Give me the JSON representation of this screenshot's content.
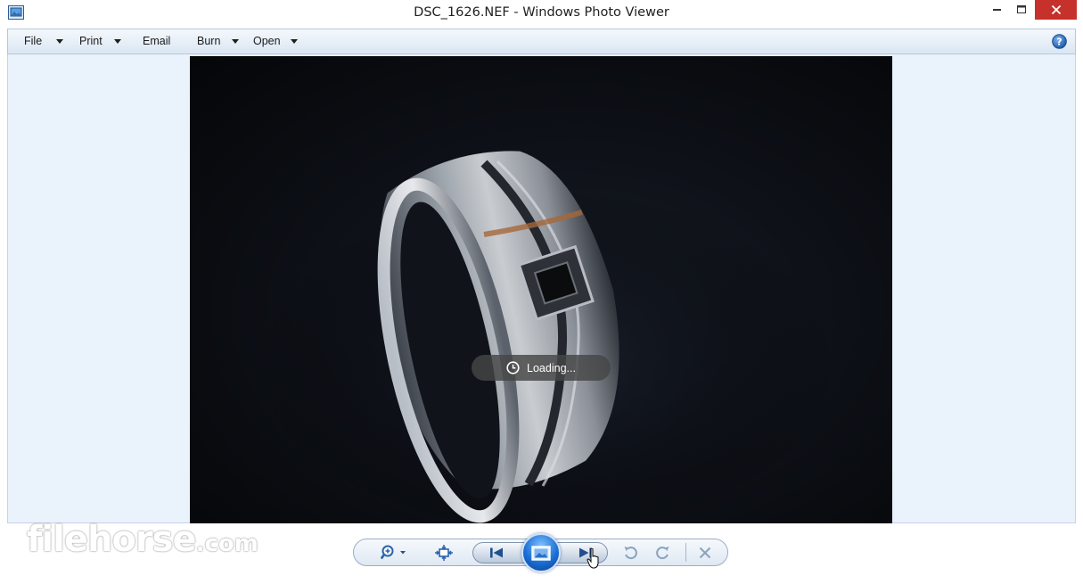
{
  "window": {
    "title": "DSC_1626.NEF - Windows Photo Viewer"
  },
  "menu": {
    "items": [
      {
        "label": "File",
        "has_dropdown": true
      },
      {
        "label": "Print",
        "has_dropdown": true
      },
      {
        "label": "Email",
        "has_dropdown": false
      },
      {
        "label": "Burn",
        "has_dropdown": true
      },
      {
        "label": "Open",
        "has_dropdown": true
      }
    ],
    "help_icon": "help-icon"
  },
  "viewer": {
    "loading_text": "Loading...",
    "photo_subject": "ring-photo"
  },
  "toolbar": {
    "buttons": [
      "zoom",
      "fit-to-window",
      "previous",
      "slideshow",
      "next",
      "rotate-counterclockwise",
      "rotate-clockwise",
      "delete"
    ]
  },
  "watermark": {
    "brand": "filehorse",
    "domain": ".com"
  },
  "colors": {
    "close_button": "#c7312b",
    "menubar": "#dbe6f3",
    "viewer_background": "#eaf2fb",
    "slideshow_button": "#1a6fd6"
  }
}
